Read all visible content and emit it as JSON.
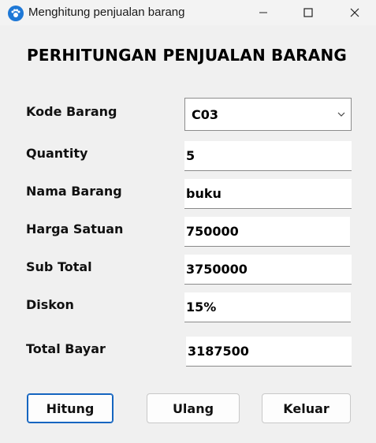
{
  "window": {
    "title": "Menghitung penjualan barang",
    "accent": "#1565c0"
  },
  "form": {
    "heading": "PERHITUNGAN PENJUALAN BARANG",
    "fields": {
      "kode_barang": {
        "label": "Kode Barang",
        "value": "C03"
      },
      "quantity": {
        "label": "Quantity",
        "value": "5"
      },
      "nama_barang": {
        "label": "Nama Barang",
        "value": "buku"
      },
      "harga_satuan": {
        "label": "Harga Satuan",
        "value": "750000"
      },
      "sub_total": {
        "label": "Sub Total",
        "value": "3750000"
      },
      "diskon": {
        "label": "Diskon",
        "value": "15%"
      },
      "total_bayar": {
        "label": "Total Bayar",
        "value": "3187500"
      }
    }
  },
  "buttons": {
    "hitung": "Hitung",
    "ulang": "Ulang",
    "keluar": "Keluar"
  },
  "icons": {
    "app": "paw-icon",
    "minimize": "minimize-icon",
    "maximize": "maximize-icon",
    "close": "close-icon",
    "dropdown": "chevron-down-icon"
  }
}
